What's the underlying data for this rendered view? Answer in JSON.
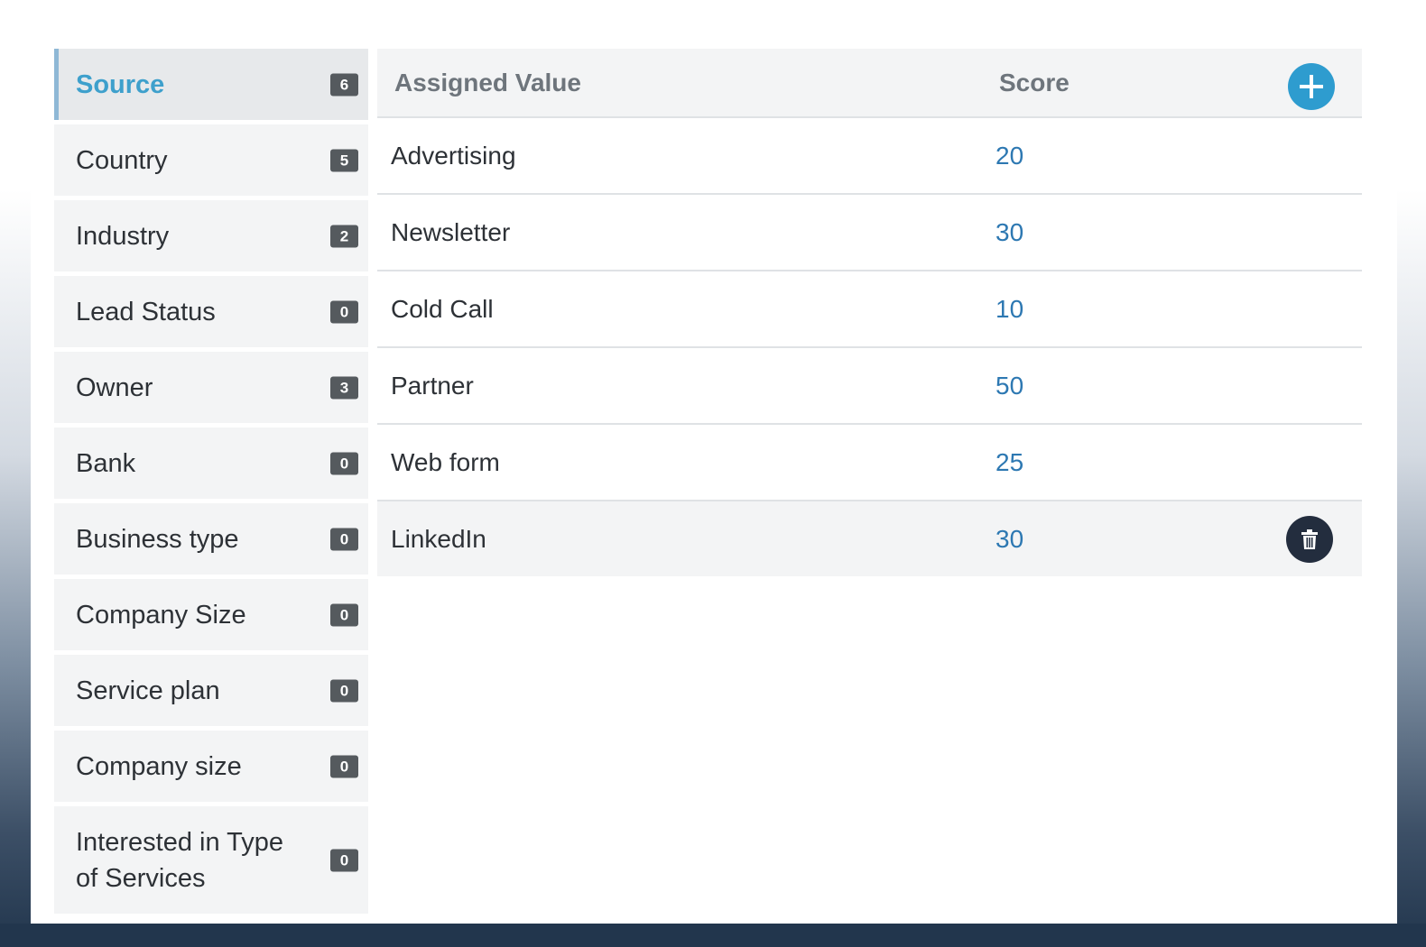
{
  "sidebar": {
    "items": [
      {
        "label": "Source",
        "count": "6"
      },
      {
        "label": "Country",
        "count": "5"
      },
      {
        "label": "Industry",
        "count": "2"
      },
      {
        "label": "Lead Status",
        "count": "0"
      },
      {
        "label": "Owner",
        "count": "3"
      },
      {
        "label": "Bank",
        "count": "0"
      },
      {
        "label": "Business type",
        "count": "0"
      },
      {
        "label": "Company Size",
        "count": "0"
      },
      {
        "label": "Service plan",
        "count": "0"
      },
      {
        "label": "Company size",
        "count": "0"
      },
      {
        "label": "Interested in Type of Services",
        "count": "0"
      }
    ],
    "active_item": "Source"
  },
  "table": {
    "headers": {
      "value": "Assigned Value",
      "score": "Score"
    },
    "rows": [
      {
        "value": "Advertising",
        "score": "20"
      },
      {
        "value": "Newsletter",
        "score": "30"
      },
      {
        "value": "Cold Call",
        "score": "10"
      },
      {
        "value": "Partner",
        "score": "50"
      },
      {
        "value": "Web form",
        "score": "25"
      },
      {
        "value": "LinkedIn",
        "score": "30"
      }
    ]
  },
  "icons": {
    "add": "plus-icon",
    "delete": "trash-icon"
  },
  "colors": {
    "accent": "#2e9ccf",
    "active_label": "#3ea0cc",
    "score_text": "#2d78b2",
    "badge": "#555a5e",
    "delete_button": "#232d3e",
    "backdrop_dark": "#22364d"
  }
}
